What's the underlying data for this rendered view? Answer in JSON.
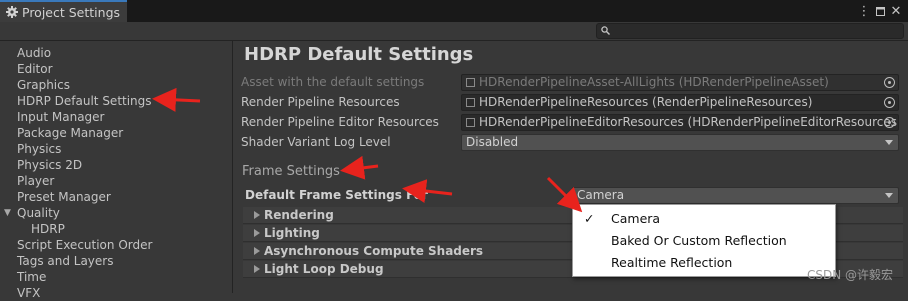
{
  "window": {
    "tab_title": "Project Settings",
    "menu_icon": "kebab-menu-icon",
    "maximize_icon": "maximize-icon",
    "close_icon": "close-icon"
  },
  "search": {
    "icon": "search-icon",
    "value": ""
  },
  "sidebar": {
    "items": [
      "Audio",
      "Editor",
      "Graphics",
      "HDRP Default Settings",
      "Input Manager",
      "Package Manager",
      "Physics",
      "Physics 2D",
      "Player",
      "Preset Manager",
      "Quality",
      "HDRP",
      "Script Execution Order",
      "Tags and Layers",
      "Time",
      "VFX"
    ]
  },
  "main": {
    "title": "HDRP Default Settings",
    "rows": [
      {
        "label": "Asset with the default settings",
        "value": "HDRenderPipelineAsset-AllLights (HDRenderPipelineAsset)"
      },
      {
        "label": "Render Pipeline Resources",
        "value": "HDRenderPipelineResources (RenderPipelineResources)"
      },
      {
        "label": "Render Pipeline Editor Resources",
        "value": "HDRenderPipelineEditorResources (HDRenderPipelineEditorResources)"
      },
      {
        "label": "Shader Variant Log Level",
        "value": "Disabled"
      }
    ],
    "frame_settings_title": "Frame Settings",
    "default_frame_settings_label": "Default Frame Settings For",
    "default_frame_settings_value": "Camera",
    "foldouts": [
      "Rendering",
      "Lighting",
      "Asynchronous Compute Shaders",
      "Light Loop Debug"
    ]
  },
  "popup": {
    "check": "✓",
    "options": [
      "Camera",
      "Baked Or Custom Reflection",
      "Realtime Reflection"
    ],
    "selected": "Camera"
  },
  "watermark": "CSDN @许毅宏",
  "colors": {
    "accent_tab": "#3a79bb",
    "annotation_arrow": "#e8231d",
    "background": "#383838"
  }
}
